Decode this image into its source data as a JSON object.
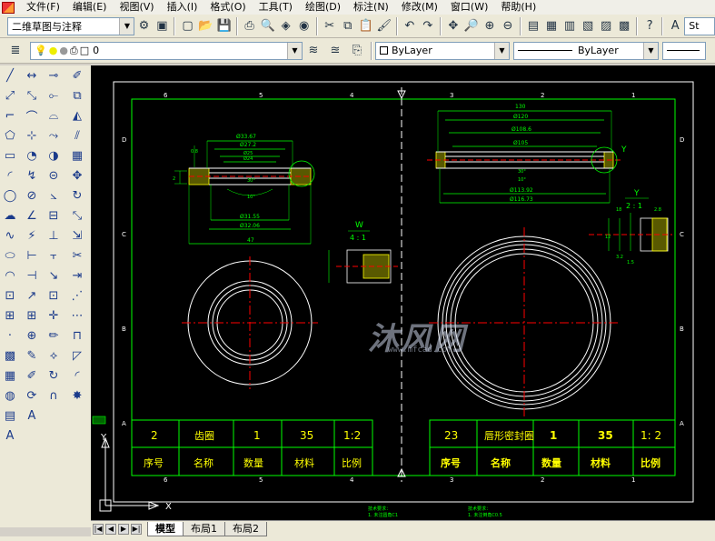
{
  "menubar": {
    "items": [
      "文件(F)",
      "编辑(E)",
      "视图(V)",
      "插入(I)",
      "格式(O)",
      "工具(T)",
      "绘图(D)",
      "标注(N)",
      "修改(M)",
      "窗口(W)",
      "帮助(H)"
    ]
  },
  "toolbar1": {
    "workspace_value": "二维草图与注释",
    "style_value": "St"
  },
  "toolbar2": {
    "layer_value": "0",
    "color_value": "ByLayer",
    "linetype_value": "ByLayer"
  },
  "layout_tabs": [
    "模型",
    "布局1",
    "布局2"
  ],
  "drawing": {
    "ucs_y": "Y",
    "ucs_x": "X",
    "left_part": {
      "dims": [
        "Ø33.67",
        "Ø27.2",
        "Ø25",
        "Ø24",
        "Ø31.55",
        "Ø32.06",
        "47",
        "0.8",
        "2",
        "30°",
        "10°"
      ],
      "detail_label": "W",
      "detail_scale": "4 : 1"
    },
    "right_part": {
      "dims": [
        "130",
        "Ø120",
        "Ø108.6",
        "Ø105",
        "Ø113.92",
        "Ø116.73",
        "30°",
        "10°"
      ],
      "detail_label": "Y",
      "detail_scale": "2 : 1",
      "detail_mark": "Y",
      "detail_dims": [
        "12",
        "18",
        "1.5",
        "2.8",
        "3.2"
      ]
    },
    "title_block_left": {
      "values": [
        "2",
        "齿圈",
        "1",
        "35",
        "1:2"
      ],
      "headers": [
        "序号",
        "名称",
        "数量",
        "材料",
        "比例"
      ]
    },
    "title_block_right": {
      "values": [
        "23",
        "唇形密封圈",
        "1",
        "35",
        "1: 2"
      ],
      "headers": [
        "序号",
        "名称",
        "数量",
        "材料",
        "比例"
      ]
    },
    "notes": [
      "技术要求：",
      "1. 未注圆角C1",
      "技术要求：",
      "1. 未注倒角C0.5"
    ],
    "zone_numbers_top": [
      "6",
      "5",
      "4",
      "3",
      "2",
      "1"
    ],
    "zone_letters_side": [
      "D",
      "C",
      "B",
      "A"
    ]
  },
  "watermark": {
    "text": "沐风网",
    "url": "www.mfcad.com"
  },
  "colors": {
    "canvas": "#000000",
    "frame": "#ffffff",
    "green": "#00ff00",
    "red": "#ff0000",
    "yellow": "#ffff00",
    "center": "#ff0000"
  }
}
